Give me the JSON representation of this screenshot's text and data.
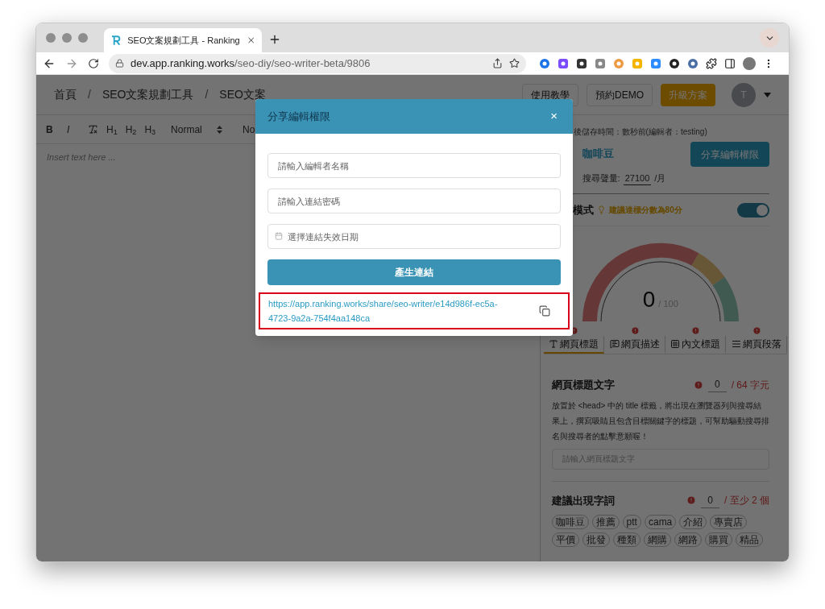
{
  "browser": {
    "tab_title": "SEO文案規劃工具 - Ranking",
    "url_host": "dev.app.ranking.works",
    "url_path": "/seo-diy/seo-writer-beta/9806"
  },
  "header": {
    "breadcrumbs": [
      {
        "kind": "link",
        "text": "首頁"
      },
      {
        "kind": "separator",
        "text": "/"
      },
      {
        "kind": "link",
        "text": "SEO文案規劃工具"
      },
      {
        "kind": "separator",
        "text": "/"
      },
      {
        "kind": "link",
        "text": "SEO文案"
      }
    ],
    "buttons": [
      {
        "label": "使用教學",
        "kind": "outline"
      },
      {
        "label": "預約DEMO",
        "kind": "outline"
      },
      {
        "label": "升級方案",
        "kind": "primary"
      }
    ],
    "avatar": "T"
  },
  "editor": {
    "toolbar": [
      {
        "kind": "bold",
        "label": "B"
      },
      {
        "kind": "italic",
        "label": "I"
      },
      {
        "kind": "clear"
      },
      {
        "kind": "heading",
        "label": "H$_{1}$"
      },
      {
        "kind": "heading",
        "label": "H$_{2}$"
      },
      {
        "kind": "heading",
        "label": "H$_{3}$"
      },
      {
        "kind": "select",
        "label": "Normal"
      },
      {
        "kind": "text",
        "label": "No"
      }
    ],
    "placeholder": "Insert text here ..."
  },
  "panel": {
    "saved_text": "後儲存時間：數秒前(編輯者：testing)",
    "keyword": "咖啡豆",
    "share_button": "分享編輯權限",
    "volume_label": "搜尋聲量:",
    "volume": "27100",
    "volume_unit": "/月",
    "mode_label": "模式",
    "mode_hint": "建議達標分數為80分",
    "mode_on": true,
    "score": "0",
    "score_max": "/ 100",
    "tabs": [
      {
        "label": "網頁標題",
        "kind": "title",
        "selected": true,
        "alert": true
      },
      {
        "label": "網頁描述",
        "kind": "description",
        "selected": false,
        "alert": true
      },
      {
        "label": "內文標題",
        "kind": "heading",
        "selected": false,
        "alert": true
      },
      {
        "label": "網頁段落",
        "kind": "paragraph",
        "selected": false,
        "alert": true
      }
    ],
    "title_section": {
      "heading": "網頁標題文字",
      "count": "0",
      "limit": "/ 64 字元",
      "description": "放置於 <head> 中的 title 標籤，將出現在瀏覽器列與搜尋結果上，撰寫吸睛且包含目標關鍵字的標題，可幫助驅動搜尋排名與搜尋者的點擊意願喔！",
      "placeholder": "請輸入網頁標題文字"
    },
    "keywords_section": {
      "heading": "建議出現字詞",
      "count": "0",
      "limit": "/ 至少 2 個",
      "tags": [
        "咖啡豆",
        "推薦",
        "ptt",
        "cama",
        "介紹",
        "專賣店",
        "平價",
        "批發",
        "種類",
        "網購",
        "網路",
        "購買",
        "精品"
      ]
    }
  },
  "modal": {
    "title": "分享編輯權限",
    "close": "×",
    "fields": [
      {
        "kind": "text",
        "placeholder": "請輸入編輯者名稱"
      },
      {
        "kind": "text",
        "placeholder": "請輸入連結密碼"
      },
      {
        "kind": "date",
        "placeholder": "選擇連結失效日期"
      }
    ],
    "button": "產生連結",
    "link": "https://app.ranking.works/share/seo-writer/e14d986f-ec5a-4723-9a2a-754f4aa148ca",
    "highlighted": true
  }
}
